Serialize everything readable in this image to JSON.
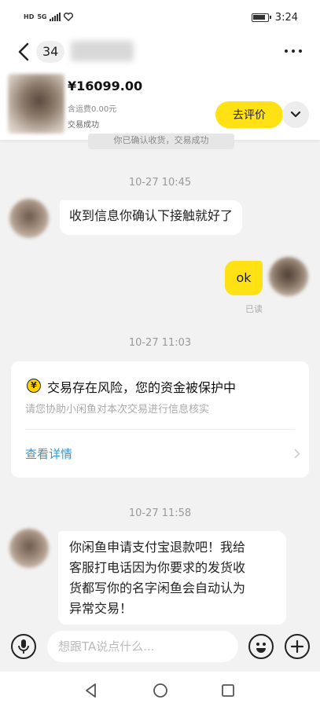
{
  "status_bar": {
    "network": "HD",
    "network_gen": "5G",
    "time": "3:24"
  },
  "header": {
    "unread_count": "34"
  },
  "order": {
    "price": "¥16099.00",
    "shipping": "含运费0.00元",
    "status": "交易成功",
    "review_label": "去评价"
  },
  "messages": {
    "cut_notice": "你已确认收货，交易成功",
    "time_1": "10-27 10:45",
    "msg_1": "收到信息你确认下接触就好了",
    "msg_2": "ok",
    "read_label": "已读",
    "time_2": "10-27 11:03",
    "risk_title": "交易存在风险，您的资金被保护中",
    "risk_sub": "请您协助小闲鱼对本次交易进行信息核实",
    "risk_link": "查看详情",
    "time_3": "10-27 11:58",
    "msg_3_line1": "你闲鱼申请支付宝退款吧！我给",
    "msg_3_line2": "客服打电话因为你要求的发货收",
    "msg_3_line3": "货都写你的名字闲鱼会自动认为",
    "msg_3_line4": "异常交易！"
  },
  "input": {
    "placeholder": "想跟TA说点什么..."
  },
  "icons": {
    "back": "chevron-left-icon",
    "more": "more-icon",
    "expand": "chevron-down-icon",
    "risk": "yen-shield-icon",
    "voice": "microphone-icon",
    "emoji": "smile-icon",
    "add": "plus-icon",
    "nav_back": "triangle-back-icon",
    "nav_home": "circle-home-icon",
    "nav_recent": "square-recent-icon"
  },
  "colors": {
    "accent_yellow": "#ffe114",
    "link_blue": "#2b9bdb",
    "background": "#f2f2f2"
  }
}
